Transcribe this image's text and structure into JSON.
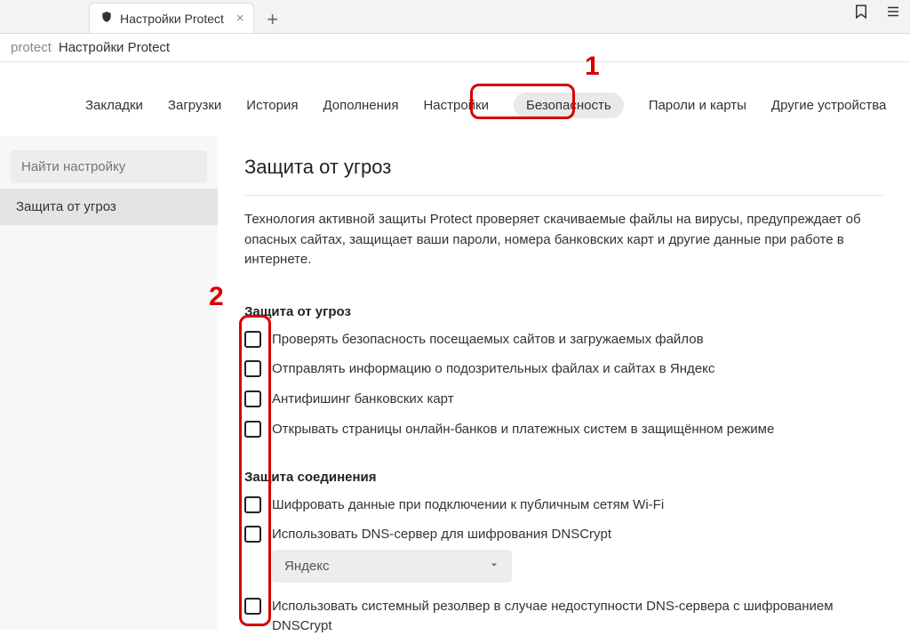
{
  "tab": {
    "title": "Настройки Protect"
  },
  "addr": {
    "scheme": "protect",
    "title": "Настройки Protect"
  },
  "nav": [
    "Закладки",
    "Загрузки",
    "История",
    "Дополнения",
    "Настройки",
    "Безопасность",
    "Пароли и карты",
    "Другие устройства"
  ],
  "active_nav_index": 5,
  "search_placeholder": "Найти настройку",
  "sidebar": {
    "items": [
      "Защита от угроз"
    ],
    "active_index": 0
  },
  "page": {
    "heading": "Защита от угроз",
    "description": "Технология активной защиты Protect проверяет скачиваемые файлы на вирусы, предупреждает об опасных сайтах, защищает ваши пароли, номера банковских карт и другие данные при работе в интернете."
  },
  "groups": [
    {
      "title": "Защита от угроз",
      "options": [
        "Проверять безопасность посещаемых сайтов и загружаемых файлов",
        "Отправлять информацию о подозрительных файлах и сайтах в Яндекс",
        "Антифишинг банковских карт",
        "Открывать страницы онлайн-банков и платежных систем в защищённом режиме"
      ]
    },
    {
      "title": "Защита соединения",
      "options": [
        "Шифровать данные при подключении к публичным сетям Wi-Fi",
        "Использовать DNS-сервер для шифрования DNSCrypt",
        "Использовать системный резолвер в случае недоступности DNS-сервера с шифрованием DNSCrypt"
      ],
      "dnscrypt_selected": "Яндекс"
    }
  ],
  "annotations": {
    "one": "1",
    "two": "2"
  }
}
